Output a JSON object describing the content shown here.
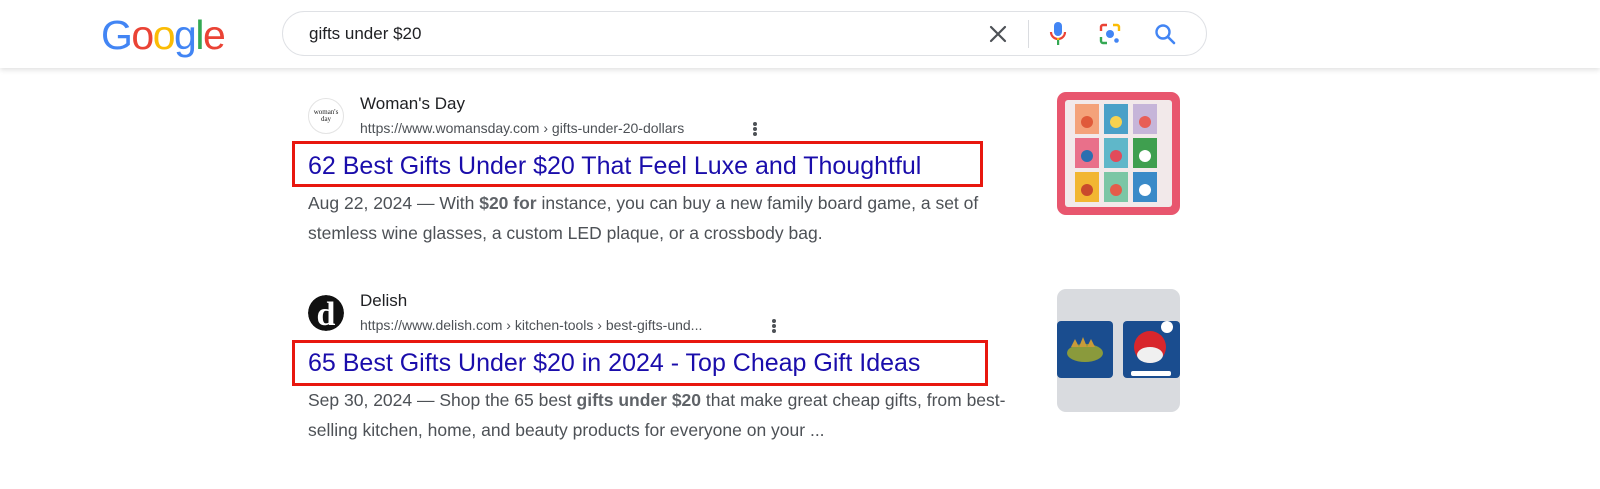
{
  "header": {
    "logo_letters": [
      {
        "ch": "G",
        "color": "#4285f4"
      },
      {
        "ch": "o",
        "color": "#ea4335"
      },
      {
        "ch": "o",
        "color": "#fbbc05"
      },
      {
        "ch": "g",
        "color": "#4285f4"
      },
      {
        "ch": "l",
        "color": "#34a853"
      },
      {
        "ch": "e",
        "color": "#ea4335"
      }
    ],
    "search_query": "gifts under $20",
    "icons": [
      "close-icon",
      "microphone-icon",
      "lens-icon",
      "search-icon"
    ]
  },
  "results": [
    {
      "site_name": "Woman's Day",
      "url": "https://www.womansday.com › gifts-under-20-dollars",
      "favicon_text": "woman's day",
      "title": "62 Best Gifts Under $20 That Feel Luxe and Thoughtful",
      "date": "Aug 22, 2024",
      "snippet_parts": [
        {
          "text": "Aug 22, 2024 — With ",
          "bold": false
        },
        {
          "text": "$20 for",
          "bold": true
        },
        {
          "text": " instance, you can buy a new family board game, a set of stemless wine glasses, a custom LED plaque, or a crossbody bag.",
          "bold": false
        }
      ],
      "thumb_bg": "#e8566e"
    },
    {
      "site_name": "Delish",
      "url": "https://www.delish.com › kitchen-tools › best-gifts-und...",
      "favicon_text": "d",
      "title": "65 Best Gifts Under $20 in 2024 - Top Cheap Gift Ideas",
      "date": "Sep 30, 2024",
      "snippet_parts": [
        {
          "text": "Sep 30, 2024 — Shop the 65 best ",
          "bold": false
        },
        {
          "text": "gifts under $20",
          "bold": true
        },
        {
          "text": " that make great cheap gifts, from best-selling kitchen, home, and beauty products for everyone on your ...",
          "bold": false
        }
      ],
      "thumb_bg": "#d9dbdf"
    }
  ],
  "colors": {
    "link": "#1a0dab",
    "highlight_box": "#e8170f"
  }
}
